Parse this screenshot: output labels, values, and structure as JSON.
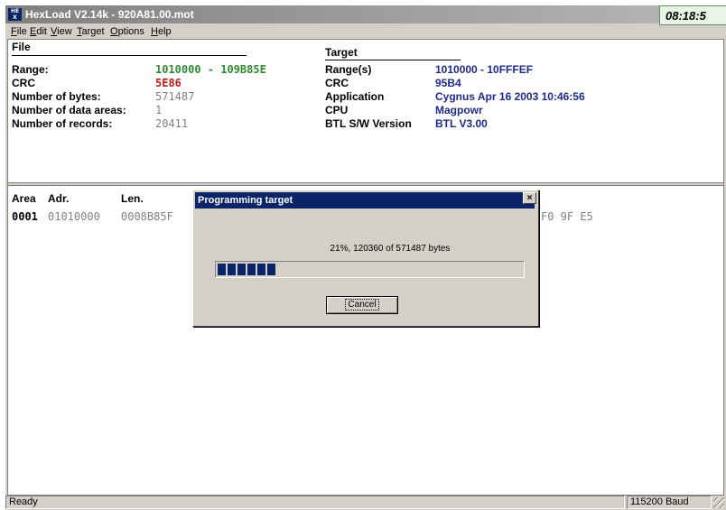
{
  "window": {
    "title": "HexLoad V2.14k - 920A81.00.mot",
    "icon": "hex-icon",
    "clock": "08:18:5"
  },
  "menu": [
    {
      "label": "File",
      "accel": "F",
      "rest": "ile"
    },
    {
      "label": "Edit",
      "accel": "E",
      "rest": "dit"
    },
    {
      "label": "View",
      "accel": "V",
      "rest": "iew"
    },
    {
      "label": "Target",
      "accel": "T",
      "rest": "arget"
    },
    {
      "label": "Options",
      "accel": "O",
      "rest": "ptions"
    },
    {
      "label": "Help",
      "accel": "H",
      "rest": "elp"
    }
  ],
  "file_section": {
    "title": "File",
    "rows": [
      {
        "label": "Range:",
        "value": "1010000 - 109B85E"
      },
      {
        "label": "CRC",
        "value": "5E86"
      },
      {
        "label": "Number of bytes:",
        "value": "571487"
      },
      {
        "label": "Number of data areas:",
        "value": "1"
      },
      {
        "label": "Number of records:",
        "value": "20411"
      }
    ]
  },
  "target_section": {
    "title": "Target",
    "rows": [
      {
        "label": "Range(s)",
        "value": "1010000 - 10FFFEF"
      },
      {
        "label": "CRC",
        "value": "95B4"
      },
      {
        "label": "Application",
        "value": "Cygnus Apr 16 2003 10:46:56"
      },
      {
        "label": "CPU",
        "value": "Magpowr"
      },
      {
        "label": "BTL S/W Version",
        "value": "BTL V3.00"
      }
    ]
  },
  "areas_table": {
    "headers": [
      "Area",
      "Adr.",
      "Len."
    ],
    "rows": [
      {
        "area": "0001",
        "adr": "01010000",
        "len": "0008B85F",
        "data_tail": "F0 9F E5"
      }
    ]
  },
  "dialog": {
    "title": "Programming target",
    "message": "21%, 120360 of 571487 bytes",
    "progress_fraction": 0.21,
    "cancel_label": "Cancel",
    "close_label": "×"
  },
  "status": {
    "text": "Ready",
    "baud": "115200 Baud"
  },
  "colors": {
    "accent": "#0a246a",
    "file_green": "#2e8b2e",
    "file_red": "#c01818",
    "target_blue": "#1c2a8c"
  }
}
